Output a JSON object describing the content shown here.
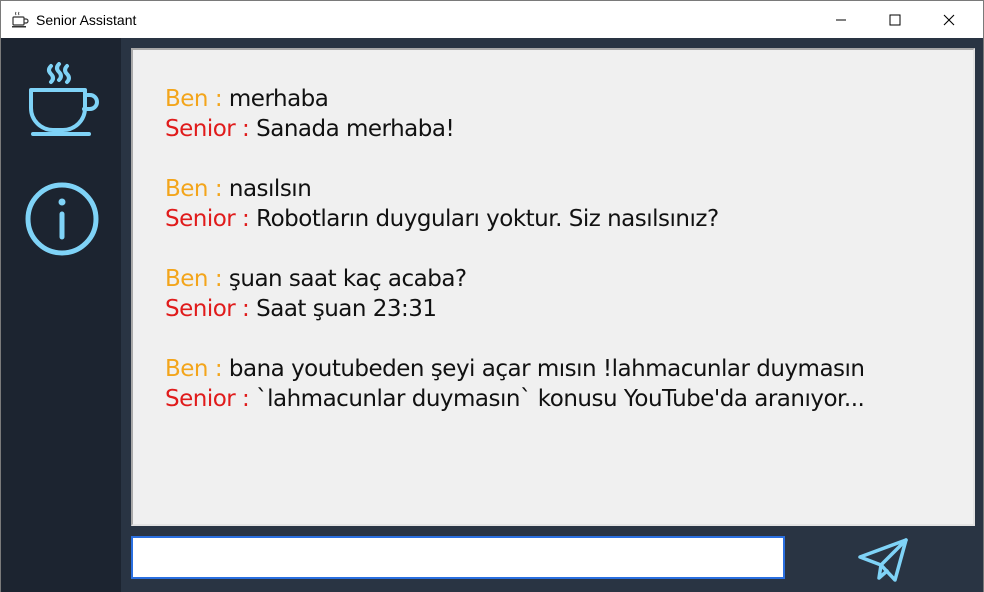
{
  "window": {
    "title": "Senior Assistant",
    "accent_color": "#7fd3f7",
    "ben_color": "#f3a51b",
    "senior_color": "#e01b1b"
  },
  "titlebar_icons": [
    "coffee-cup-icon",
    "minimize-icon",
    "maximize-icon",
    "close-icon"
  ],
  "sidebar": {
    "items": [
      {
        "icon": "coffee-cup-icon"
      },
      {
        "icon": "info-icon"
      }
    ]
  },
  "chat": {
    "conversations": [
      {
        "user_label": "Ben : ",
        "user_text": "merhaba",
        "bot_label": "Senior : ",
        "bot_text": "Sanada merhaba!"
      },
      {
        "user_label": "Ben : ",
        "user_text": "nasılsın",
        "bot_label": "Senior : ",
        "bot_text": "Robotların duyguları yoktur. Siz nasılsınız?"
      },
      {
        "user_label": "Ben : ",
        "user_text": "şuan saat kaç acaba?",
        "bot_label": "Senior : ",
        "bot_text": "Saat şuan 23:31"
      },
      {
        "user_label": "Ben : ",
        "user_text": "bana youtubeden şeyi açar mısın !lahmacunlar duymasın",
        "bot_label": "Senior : ",
        "bot_text": "`lahmacunlar duymasın` konusu YouTube'da aranıyor..."
      }
    ]
  },
  "input": {
    "value": "",
    "placeholder": ""
  },
  "send_button": {
    "icon": "paper-plane-icon"
  }
}
